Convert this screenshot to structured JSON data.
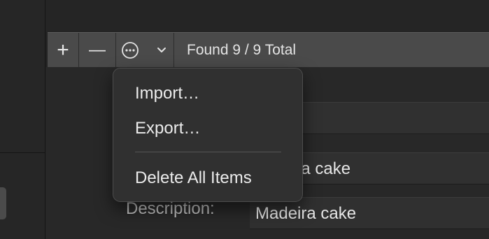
{
  "toolbar": {
    "add_label": "+",
    "remove_label": "—",
    "more_icon": "ellipsis-circle-icon",
    "chevron_icon": "chevron-down-icon",
    "status_text": "Found 9 / 9 Total"
  },
  "fields": {
    "name_value": "Madeira cake",
    "description_label": "Description:",
    "description_value": "Madeira cake"
  },
  "menu": {
    "items": [
      "Import…",
      "Export…",
      "Delete All Items"
    ]
  },
  "colors": {
    "toolbar_bg": "#4a4a4a",
    "menu_bg": "#303030",
    "window_bg": "#232323"
  }
}
